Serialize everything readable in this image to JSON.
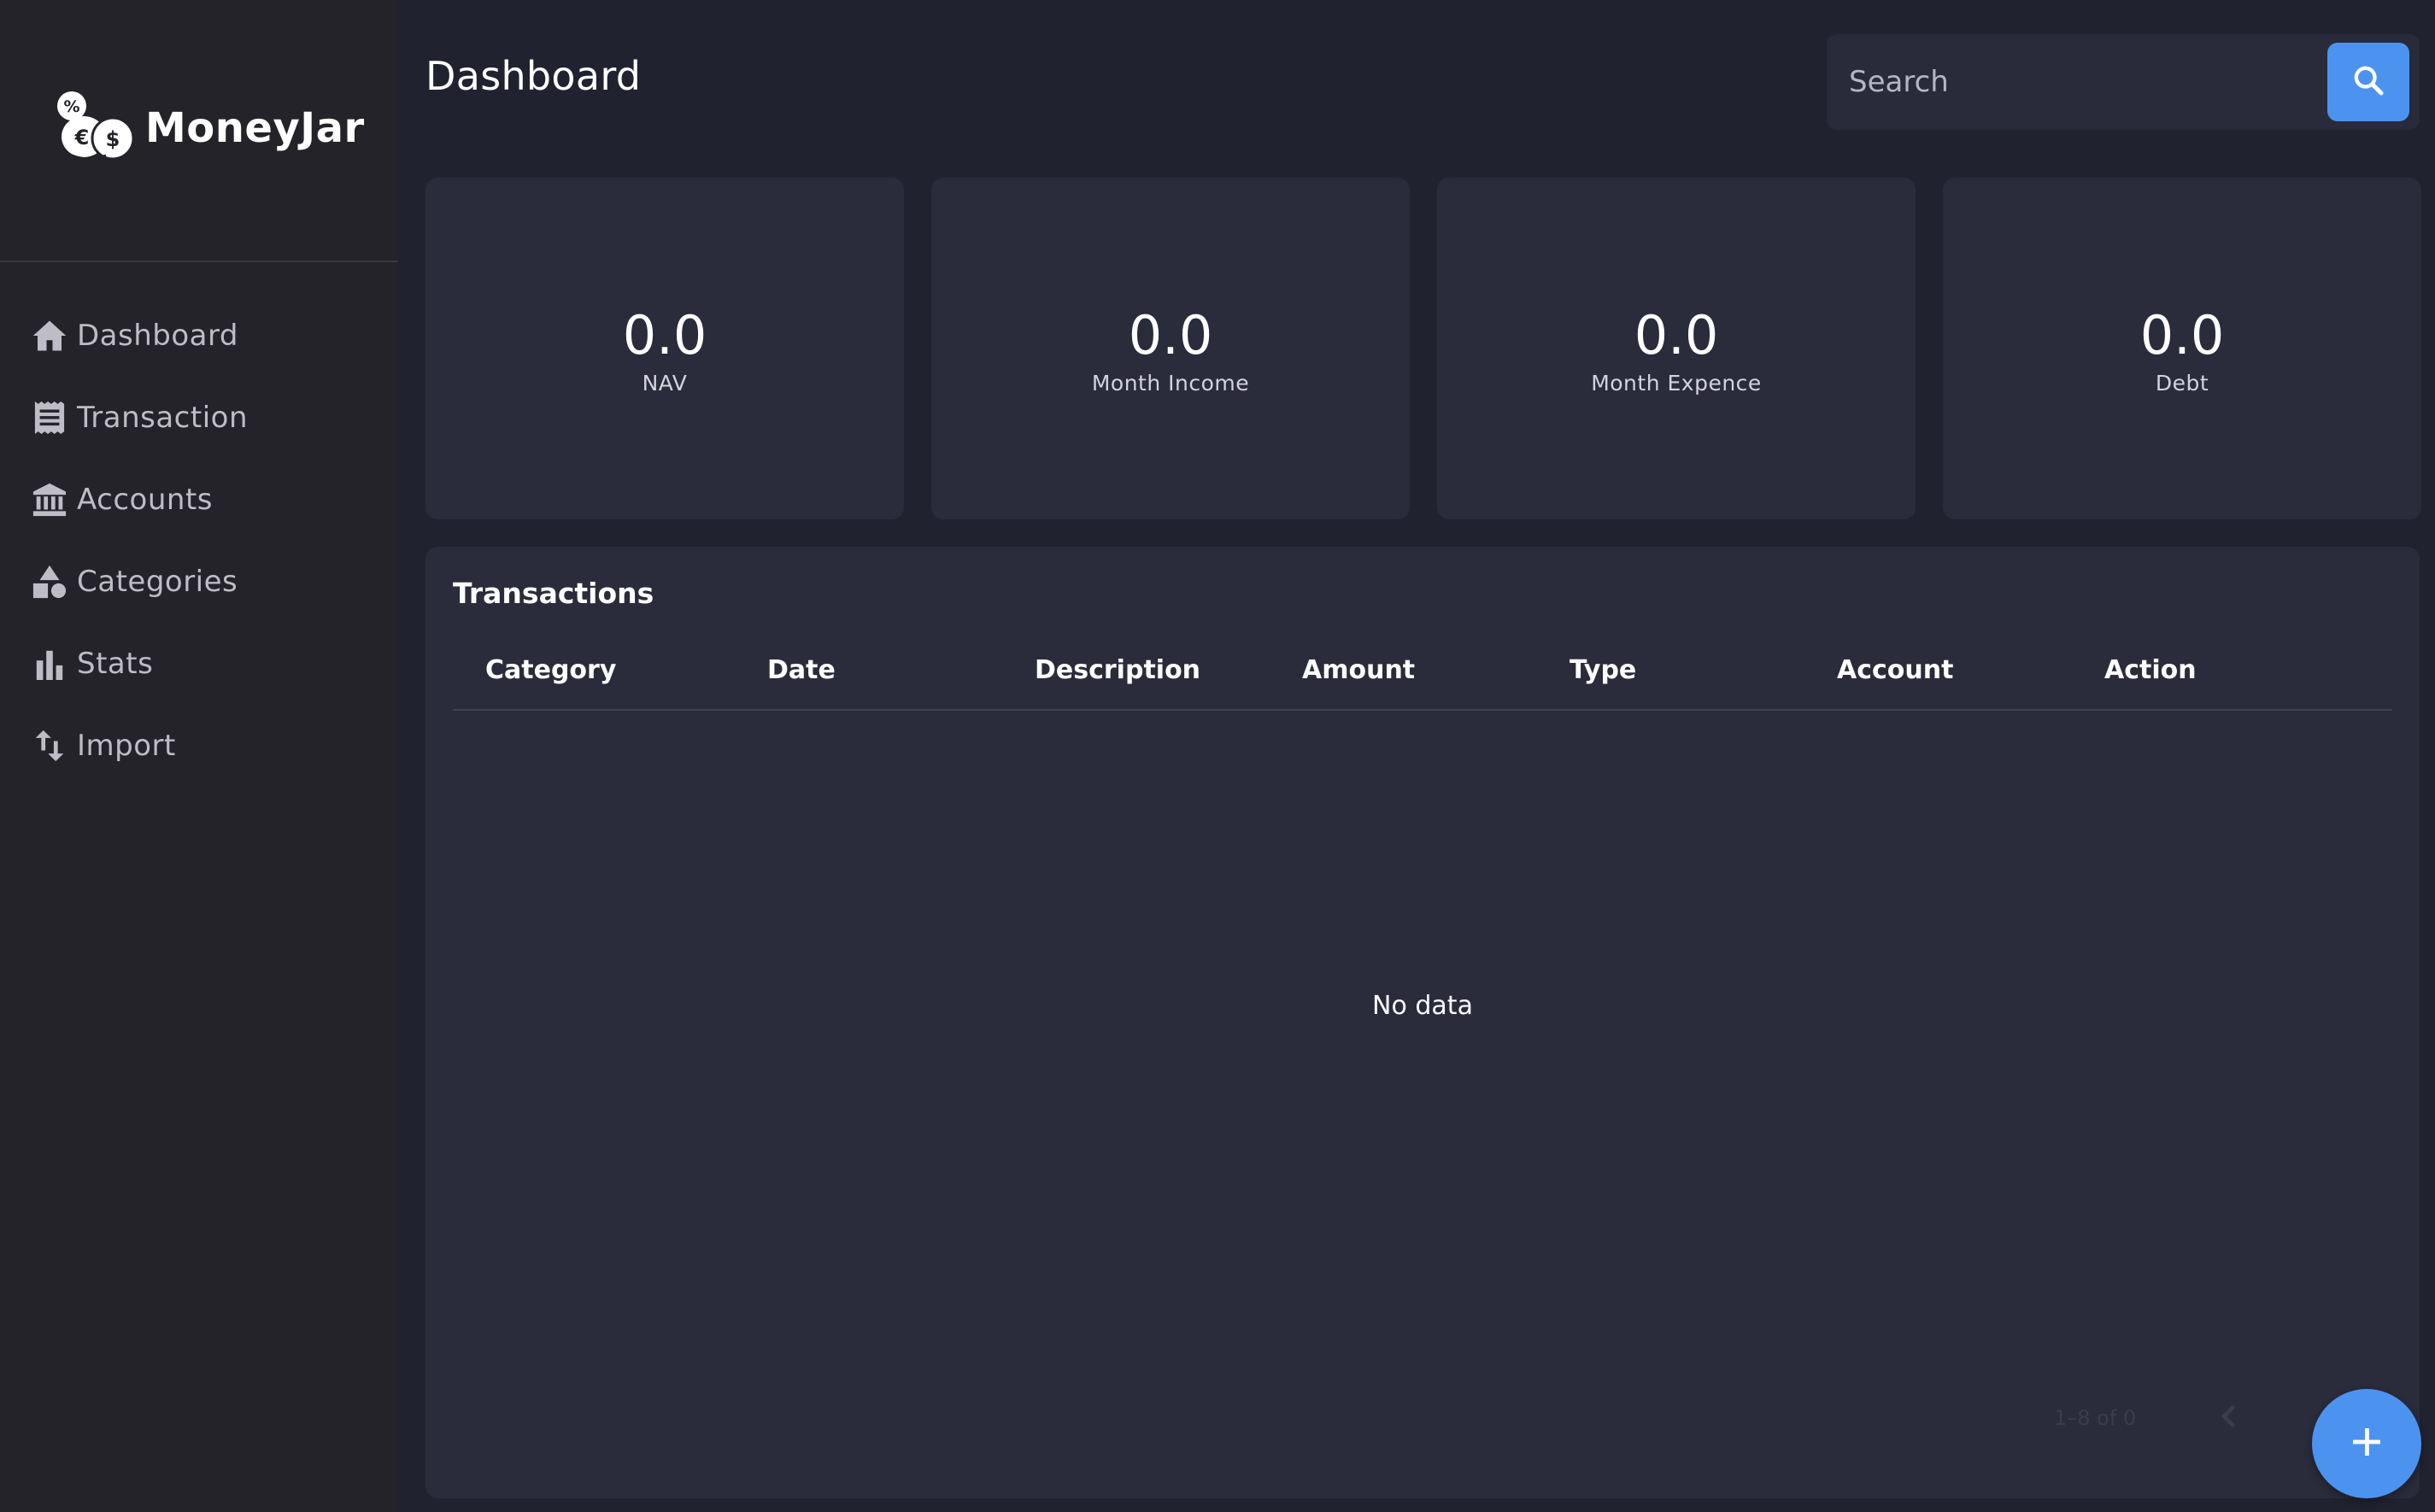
{
  "app": {
    "name": "MoneyJar",
    "logo_icon": "coins-logo-icon"
  },
  "sidebar": {
    "items": [
      {
        "label": "Dashboard",
        "icon": "home-icon"
      },
      {
        "label": "Transaction",
        "icon": "receipt-icon"
      },
      {
        "label": "Accounts",
        "icon": "bank-icon"
      },
      {
        "label": "Categories",
        "icon": "shapes-icon"
      },
      {
        "label": "Stats",
        "icon": "bar-chart-icon"
      },
      {
        "label": "Import",
        "icon": "import-arrows-icon"
      }
    ]
  },
  "header": {
    "title": "Dashboard",
    "search": {
      "placeholder": "Search",
      "value": "",
      "icon": "search-icon"
    }
  },
  "stats": [
    {
      "value": "0.0",
      "label": "NAV"
    },
    {
      "value": "0.0",
      "label": "Month Income"
    },
    {
      "value": "0.0",
      "label": "Month Expence"
    },
    {
      "value": "0.0",
      "label": "Debt"
    }
  ],
  "transactions": {
    "title": "Transactions",
    "columns": [
      "Category",
      "Date",
      "Description",
      "Amount",
      "Type",
      "Account",
      "Action"
    ],
    "rows": [],
    "empty_text": "No data",
    "pagination": {
      "text": "1–8 of 0",
      "prev_icon": "chevron-left-icon"
    }
  },
  "fab": {
    "icon": "plus-icon"
  },
  "colors": {
    "background": "#21222f",
    "sidebar": "#242329",
    "card": "#2a2b3b",
    "accent": "#4c93f0",
    "nav_text": "#bdbcc7"
  }
}
